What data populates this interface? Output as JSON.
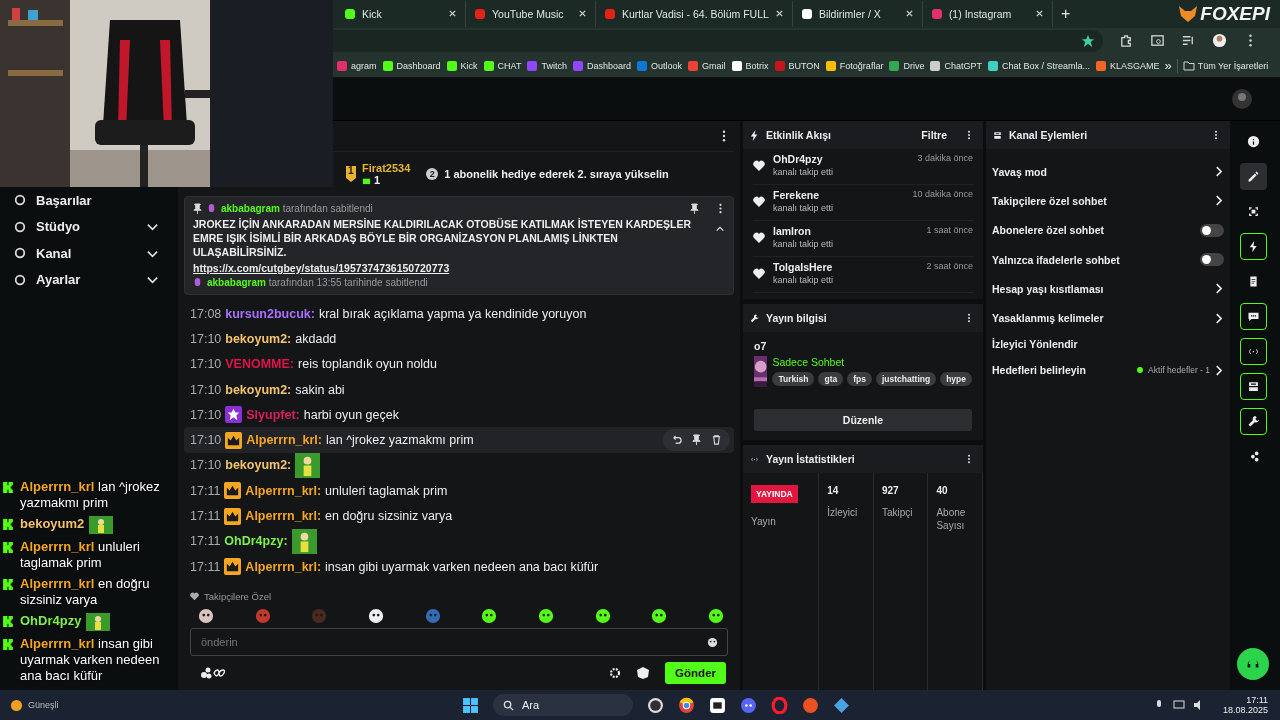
{
  "browser": {
    "tabs": [
      {
        "title": "Kick",
        "selected": false
      },
      {
        "title": "YouTube Music",
        "selected": false
      },
      {
        "title": "Kurtlar Vadisi - 64. Bölüm FULL",
        "selected": false
      },
      {
        "title": "Bildirimler / X",
        "selected": false
      },
      {
        "title": "(1) Instagram",
        "selected": false
      }
    ],
    "new_tab": "+",
    "bookmarks": [
      "agram",
      "Dashboard",
      "Kick",
      "CHAT",
      "Twitch",
      "Dashboard",
      "Outlook",
      "Gmail",
      "Botrix",
      "BUTON",
      "Fotoğraflar",
      "Drive",
      "ChatGPT",
      "Chat Box / Streamla...",
      "KLASGAME"
    ],
    "more": "»",
    "all_bookmarks": "Tüm Yer İşaretleri"
  },
  "logo": "FOXEPI",
  "sidebar": {
    "items": [
      {
        "label": "Başarılar",
        "expandable": false
      },
      {
        "label": "Stüdyo",
        "expandable": true
      },
      {
        "label": "Kanal",
        "expandable": true
      },
      {
        "label": "Ayarlar",
        "expandable": true
      }
    ]
  },
  "chat": {
    "leader": {
      "rank": "1",
      "name": "Firat2534",
      "count": "1"
    },
    "promo_rank": "2",
    "promo": "1 abonelik hediye ederek 2. sıraya yükselin",
    "pinned": {
      "by": "akbabagram",
      "by_suffix": "tarafından sabitlendi",
      "text": "JROKEZ İÇİN ANKARADAN MERSİNE KALDIRILACAK OTOBÜSE KATILMAK İSTEYEN KARDEŞLER EMRE IŞIK İSİMLİ BİR ARKADAŞ BÖYLE BİR ORGANİZASYON PLANLAMIŞ LİNKTEN ULAŞABİLİRSİNİZ.",
      "link": "https://x.com/cutgbey/status/1957374736150720773",
      "footer_by": "akbabagram",
      "footer_suffix": "tarafından 13:55 tarihinde sabitlendi"
    },
    "messages": [
      {
        "time": "17:08",
        "user": "kursun2bucuk:",
        "color": "#a970ff",
        "star_badge": false,
        "crown_badge": false,
        "kind": "text",
        "text": "kral bırak açıklama yapma ya kendinide yoruyon",
        "highlighted": false
      },
      {
        "time": "17:10",
        "user": "bekoyum2:",
        "color": "#f2c46d",
        "star_badge": false,
        "crown_badge": false,
        "kind": "text",
        "text": "akdadd",
        "highlighted": false
      },
      {
        "time": "17:10",
        "user": "VENOMME:",
        "color": "#e0134b",
        "star_badge": false,
        "crown_badge": false,
        "kind": "text",
        "text": "reis toplandık oyun noldu",
        "highlighted": false
      },
      {
        "time": "17:10",
        "user": "bekoyum2:",
        "color": "#f2c46d",
        "star_badge": false,
        "crown_badge": false,
        "kind": "text",
        "text": "sakin abi",
        "highlighted": false
      },
      {
        "time": "17:10",
        "user": "Slyupfet:",
        "color": "#d61f5b",
        "star_badge": true,
        "crown_badge": false,
        "kind": "text",
        "text": "harbi oyun geçek",
        "highlighted": false
      },
      {
        "time": "17:10",
        "user": "Alperrrn_krl:",
        "color": "#f5a623",
        "star_badge": false,
        "crown_badge": true,
        "kind": "text",
        "text": "lan ^jrokez yazmakmı prim",
        "highlighted": true
      },
      {
        "time": "17:10",
        "user": "bekoyum2:",
        "color": "#f2c46d",
        "star_badge": false,
        "crown_badge": false,
        "kind": "emote",
        "highlighted": false
      },
      {
        "time": "17:11",
        "user": "Alperrrn_krl:",
        "color": "#f5a623",
        "star_badge": false,
        "crown_badge": true,
        "kind": "text",
        "text": "unluleri taglamak prim",
        "highlighted": false
      },
      {
        "time": "17:11",
        "user": "Alperrrn_krl:",
        "color": "#f5a623",
        "star_badge": false,
        "crown_badge": true,
        "kind": "text",
        "text": "en doğru sizsiniz varya",
        "highlighted": false
      },
      {
        "time": "17:11",
        "user": "OhDr4pzy:",
        "color": "#7ef04a",
        "star_badge": false,
        "crown_badge": false,
        "kind": "emote",
        "highlighted": false
      },
      {
        "time": "17:11",
        "user": "Alperrrn_krl:",
        "color": "#f5a623",
        "star_badge": false,
        "crown_badge": true,
        "kind": "text",
        "text": "insan gibi uyarmak varken nedeen ana bacı küfür",
        "highlighted": false
      }
    ],
    "emote_section": "Takipçilere Özel",
    "input_placeholder": "önderin",
    "send": "Gönder"
  },
  "events": {
    "title": "Etkinlik Akışı",
    "filter": "Filtre",
    "items": [
      {
        "name": "OhDr4pzy",
        "action": "kanalı takip etti",
        "time": "3 dakika önce"
      },
      {
        "name": "Ferekene",
        "action": "kanalı takip etti",
        "time": "10 dakika önce"
      },
      {
        "name": "lamlron",
        "action": "kanalı takip etti",
        "time": "1 saat önce"
      },
      {
        "name": "TolgaIsHere",
        "action": "kanalı takip etti",
        "time": "2 saat önce"
      }
    ]
  },
  "stream_info": {
    "title": "Yayın bilgisi",
    "stream_title": "o7",
    "category": "Sadece Sohbet",
    "tags": [
      "Turkish",
      "gta",
      "fps",
      "justchatting",
      "hype"
    ],
    "edit": "Düzenle"
  },
  "stats": {
    "title": "Yayın İstatistikleri",
    "live": "YAYINDA",
    "live_label": "Yayın",
    "items": [
      {
        "value": "14",
        "label": "İzleyici"
      },
      {
        "value": "927",
        "label": "Takipçi"
      },
      {
        "value": "40",
        "label": "Abone Sayısı"
      }
    ]
  },
  "channel_actions": {
    "title": "Kanal Eylemleri",
    "items": [
      {
        "label": "Yavaş mod",
        "kind": "link"
      },
      {
        "label": "Takipçilere özel sohbet",
        "kind": "link"
      },
      {
        "label": "Abonelere özel sohbet",
        "kind": "toggle",
        "on": false
      },
      {
        "label": "Yalnızca ifadelerle sohbet",
        "kind": "toggle",
        "on": false
      },
      {
        "label": "Hesap yaşı kısıtlaması",
        "kind": "link"
      },
      {
        "label": "Yasaklanmış kelimeler",
        "kind": "link"
      },
      {
        "label": "İzleyici Yönlendir",
        "kind": "plain"
      },
      {
        "label": "Hedefleri belirleyin",
        "kind": "goal",
        "status": "Aktif hedefler - 1",
        "color": "#53fc18"
      }
    ]
  },
  "rail": [
    {
      "selected": false,
      "outlined": false
    },
    {
      "selected": true,
      "outlined": false
    },
    {
      "selected": false,
      "outlined": false
    },
    {
      "selected": false,
      "outlined": true
    },
    {
      "selected": false,
      "outlined": false
    },
    {
      "selected": false,
      "outlined": true
    },
    {
      "selected": false,
      "outlined": true
    },
    {
      "selected": false,
      "outlined": true
    },
    {
      "selected": false,
      "outlined": true
    },
    {
      "selected": false,
      "outlined": false
    }
  ],
  "overlay_chat": [
    {
      "user": "Alperrrn_krl",
      "color": "#f5a623",
      "kind": "text",
      "text": "lan ^jrokez yazmakmı prim"
    },
    {
      "user": "bekoyum2",
      "color": "#f2c46d",
      "kind": "emote"
    },
    {
      "user": "Alperrrn_krl",
      "color": "#f5a623",
      "kind": "text",
      "text": "unluleri taglamak prim"
    },
    {
      "user": "Alperrrn_krl",
      "color": "#f5a623",
      "kind": "text",
      "text": "en doğru sizsiniz varya"
    },
    {
      "user": "OhDr4pzy",
      "color": "#7ef04a",
      "kind": "emote"
    },
    {
      "user": "Alperrrn_krl",
      "color": "#f5a623",
      "kind": "text",
      "text": "insan gibi uyarmak varken nedeen ana bacı küfür"
    }
  ],
  "taskbar": {
    "weather": "Güneşli",
    "search": "Ara",
    "time": "17:11",
    "date": "18.08.2025"
  }
}
